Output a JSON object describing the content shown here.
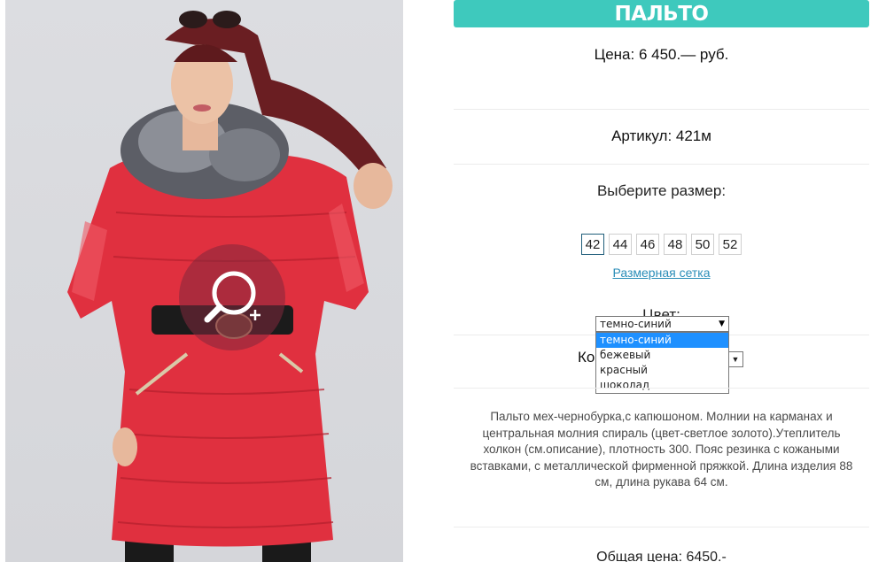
{
  "product": {
    "title": "ПАЛЬТО",
    "price": "Цена: 6 450.— руб.",
    "sku": "Артикул: 421м",
    "size_label": "Выберите размер:",
    "sizes": [
      "42",
      "44",
      "46",
      "48",
      "50",
      "52"
    ],
    "selected_size": "42",
    "size_chart_link": "Размерная сетка",
    "color_label": "Цвет:",
    "color_select": {
      "value": "темно-синий",
      "options": [
        "темно-синий",
        "бежевый",
        "красный",
        "шоколад"
      ]
    },
    "quantity_label_partial": "Ко",
    "description": "Пальто мех-чернобурка,с капюшоном. Молнии на карманах и центральная молния спираль (цвет-светлое золото).Утеплитель холкон (см.описание), плотность 300. Пояс резинка с кожаными вставками, с металлической фирменной пряжкой. Длина изделия 88 см, длина рукава 64 см.",
    "total": "Общая цена: 6450.-"
  },
  "colors": {
    "accent": "#3ec9bd",
    "link": "#2a8db8",
    "coat": "#e0303f",
    "dropdown_highlight": "#1e90ff"
  },
  "icons": {
    "zoom": "zoom-in-icon",
    "dropdown_arrow": "chevron-down-icon"
  }
}
